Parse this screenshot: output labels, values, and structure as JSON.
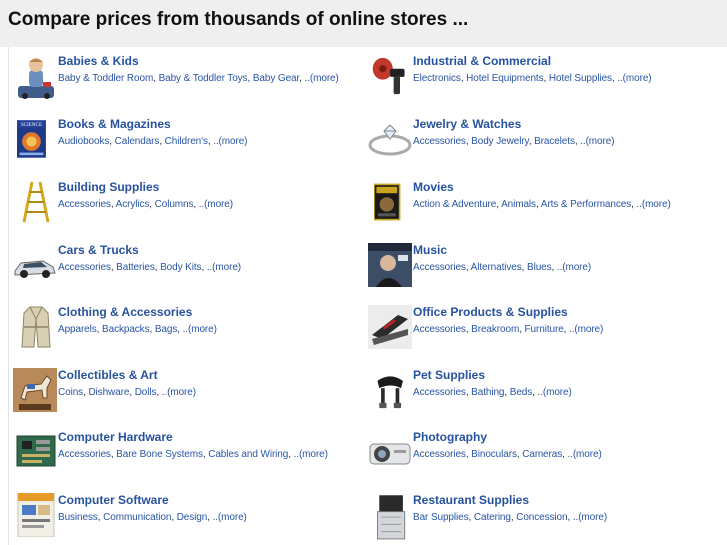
{
  "header": {
    "title": "Compare prices from thousands of online stores ..."
  },
  "categories": [
    {
      "title": "Babies & Kids",
      "icon": "baby-on-toy-icon",
      "links": [
        "Baby & Toddler Room",
        "Baby & Toddler Toys",
        "Baby Gear"
      ],
      "more": "..(more)"
    },
    {
      "title": "Books & Magazines",
      "icon": "science-magazine-icon",
      "links": [
        "Audiobooks",
        "Calendars",
        "Children's"
      ],
      "more": "..(more)"
    },
    {
      "title": "Building Supplies",
      "icon": "ladder-icon",
      "links": [
        "Accessories",
        "Acrylics",
        "Columns"
      ],
      "more": "..(more)"
    },
    {
      "title": "Cars & Trucks",
      "icon": "car-icon",
      "links": [
        "Accessories",
        "Batteries",
        "Body Kits"
      ],
      "more": "..(more)"
    },
    {
      "title": "Clothing & Accessories",
      "icon": "trench-coat-icon",
      "links": [
        "Apparels",
        "Backpacks",
        "Bags"
      ],
      "more": "..(more)"
    },
    {
      "title": "Collectibles & Art",
      "icon": "horse-figurine-icon",
      "links": [
        "Coins",
        "Dishware",
        "Dolls"
      ],
      "more": "..(more)"
    },
    {
      "title": "Computer Hardware",
      "icon": "circuit-board-icon",
      "links": [
        "Accessories",
        "Bare Bone Systems",
        "Cables and Wiring"
      ],
      "more": "..(more)"
    },
    {
      "title": "Computer Software",
      "icon": "software-box-icon",
      "links": [
        "Business",
        "Communication",
        "Design"
      ],
      "more": "..(more)"
    },
    {
      "title": "Industrial & Commercial",
      "icon": "grinder-tool-icon",
      "links": [
        "Electronics",
        "Hotel Equipments",
        "Hotel Supplies"
      ],
      "more": "..(more)"
    },
    {
      "title": "Jewelry & Watches",
      "icon": "diamond-ring-icon",
      "links": [
        "Accessories",
        "Body Jewelry",
        "Bracelets"
      ],
      "more": "..(more)"
    },
    {
      "title": "Movies",
      "icon": "dvd-cover-icon",
      "links": [
        "Action & Adventure",
        "Animals",
        "Arts & Performances"
      ],
      "more": "..(more)"
    },
    {
      "title": "Music",
      "icon": "album-cover-icon",
      "links": [
        "Accessories",
        "Alternatives",
        "Blues"
      ],
      "more": "..(more)"
    },
    {
      "title": "Office Products & Supplies",
      "icon": "stapler-icon",
      "links": [
        "Accessories",
        "Breakroom",
        "Furniture"
      ],
      "more": "..(more)"
    },
    {
      "title": "Pet Supplies",
      "icon": "saddle-icon",
      "links": [
        "Accessories",
        "Bathing",
        "Beds"
      ],
      "more": "..(more)"
    },
    {
      "title": "Photography",
      "icon": "projector-icon",
      "links": [
        "Accessories",
        "Binoculars",
        "Cameras"
      ],
      "more": "..(more)"
    },
    {
      "title": "Restaurant Supplies",
      "icon": "ice-machine-icon",
      "links": [
        "Bar Supplies",
        "Catering",
        "Concession"
      ],
      "more": "..(more)"
    }
  ]
}
